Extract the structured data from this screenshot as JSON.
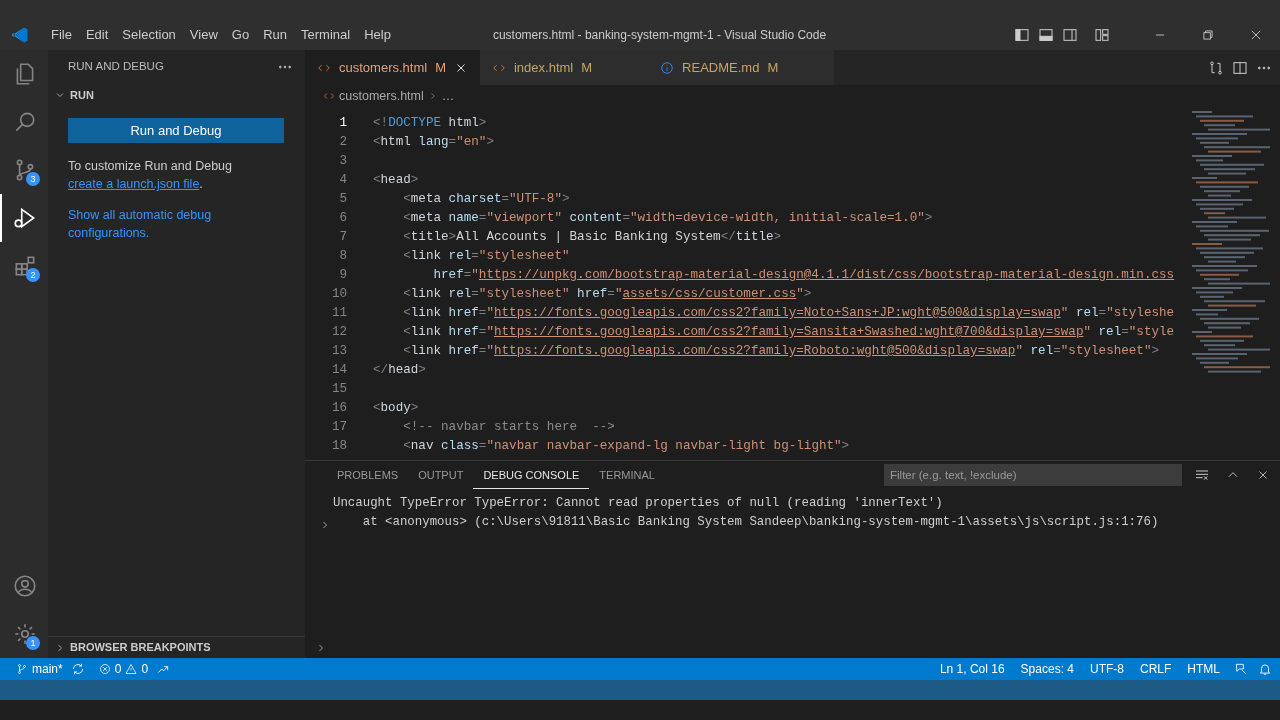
{
  "window": {
    "title": "customers.html - banking-system-mgmt-1 - Visual Studio Code"
  },
  "menu": [
    "File",
    "Edit",
    "Selection",
    "View",
    "Go",
    "Run",
    "Terminal",
    "Help"
  ],
  "activity_bar": [
    {
      "kind": "files",
      "selected": false
    },
    {
      "kind": "search",
      "selected": false
    },
    {
      "kind": "source-control",
      "badge": "3",
      "selected": false
    },
    {
      "kind": "run-debug",
      "selected": true
    },
    {
      "kind": "extensions",
      "badge": "2",
      "selected": false
    }
  ],
  "activity_bar_bottom": [
    {
      "kind": "account"
    },
    {
      "kind": "gear",
      "badge": "1"
    }
  ],
  "sidebar": {
    "title": "RUN AND DEBUG",
    "section": {
      "label": "RUN",
      "expanded": true
    },
    "button": "Run and Debug",
    "intro": "To customize Run and Debug ",
    "intro_link": "create a launch.json file",
    "intro_end": ".",
    "link": "Show all automatic debug configurations.",
    "bottom_section": {
      "label": "BROWSER BREAKPOINTS",
      "expanded": false
    }
  },
  "tabs": [
    {
      "label": "customers.html",
      "status": "M",
      "kind": "html",
      "selected": true
    },
    {
      "label": "index.html",
      "status": "M",
      "kind": "html",
      "selected": false
    },
    {
      "label": "README.md",
      "status": "M",
      "kind": "info",
      "selected": false
    }
  ],
  "breadcrumb": {
    "file": "customers.html",
    "rest": "…"
  },
  "editor": {
    "lines": [
      {
        "number": "1",
        "current": true,
        "tokens": [
          {
            "kind": "p",
            "text": "<!"
          },
          {
            "kind": "kw",
            "text": "DOCTYPE"
          },
          {
            "kind": "tag",
            "text": " html"
          },
          {
            "kind": "p",
            "text": ">"
          }
        ]
      },
      {
        "number": "2",
        "current": false,
        "tokens": [
          {
            "kind": "p",
            "text": "<"
          },
          {
            "kind": "tag",
            "text": "html"
          },
          {
            "kind": "attr",
            "text": " lang"
          },
          {
            "kind": "p",
            "text": "="
          },
          {
            "kind": "str",
            "text": "\"en\""
          },
          {
            "kind": "p",
            "text": ">"
          }
        ]
      },
      {
        "number": "3",
        "current": false
      },
      {
        "number": "4",
        "current": false,
        "tokens": [
          {
            "kind": "p",
            "text": "<"
          },
          {
            "kind": "tag",
            "text": "head"
          },
          {
            "kind": "p",
            "text": ">"
          }
        ]
      },
      {
        "number": "5",
        "current": false,
        "tokens": [
          {
            "kind": "p",
            "text": "    <"
          },
          {
            "kind": "tag",
            "text": "meta"
          },
          {
            "kind": "attr",
            "text": " charset"
          },
          {
            "kind": "p",
            "text": "="
          },
          {
            "kind": "str",
            "text": "\"UTF-8\""
          },
          {
            "kind": "p",
            "text": ">"
          }
        ]
      },
      {
        "number": "6",
        "current": false,
        "tokens": [
          {
            "kind": "p",
            "text": "    <"
          },
          {
            "kind": "tag",
            "text": "meta"
          },
          {
            "kind": "attr",
            "text": " name"
          },
          {
            "kind": "p",
            "text": "="
          },
          {
            "kind": "str",
            "text": "\"viewport\""
          },
          {
            "kind": "attr",
            "text": " content"
          },
          {
            "kind": "p",
            "text": "="
          },
          {
            "kind": "str",
            "text": "\"width=device-width, initial-scale=1.0\""
          },
          {
            "kind": "p",
            "text": ">"
          }
        ]
      },
      {
        "number": "7",
        "current": false,
        "tokens": [
          {
            "kind": "p",
            "text": "    <"
          },
          {
            "kind": "tag",
            "text": "title"
          },
          {
            "kind": "p",
            "text": ">"
          },
          {
            "kind": "txt",
            "text": "All Accounts | Basic Banking System"
          },
          {
            "kind": "p",
            "text": "</"
          },
          {
            "kind": "tag",
            "text": "title"
          },
          {
            "kind": "p",
            "text": ">"
          }
        ]
      },
      {
        "number": "8",
        "current": false,
        "tokens": [
          {
            "kind": "p",
            "text": "    <"
          },
          {
            "kind": "tag",
            "text": "link"
          },
          {
            "kind": "attr",
            "text": " rel"
          },
          {
            "kind": "p",
            "text": "="
          },
          {
            "kind": "str",
            "text": "\"stylesheet\""
          }
        ]
      },
      {
        "number": "9",
        "current": false,
        "tokens": [
          {
            "kind": "attr",
            "text": "        href"
          },
          {
            "kind": "p",
            "text": "="
          },
          {
            "kind": "str",
            "text": "\""
          },
          {
            "kind": "link",
            "text": "https://unpkg.com/bootstrap-material-design@4.1.1/dist/css/bootstrap-material-design.min.css"
          }
        ]
      },
      {
        "number": "10",
        "current": false,
        "tokens": [
          {
            "kind": "p",
            "text": "    <"
          },
          {
            "kind": "tag",
            "text": "link"
          },
          {
            "kind": "attr",
            "text": " rel"
          },
          {
            "kind": "p",
            "text": "="
          },
          {
            "kind": "str",
            "text": "\"stylesheet\""
          },
          {
            "kind": "attr",
            "text": " href"
          },
          {
            "kind": "p",
            "text": "="
          },
          {
            "kind": "str",
            "text": "\""
          },
          {
            "kind": "link",
            "text": "assets/css/customer.css"
          },
          {
            "kind": "str",
            "text": "\""
          },
          {
            "kind": "p",
            "text": ">"
          }
        ]
      },
      {
        "number": "11",
        "current": false,
        "tokens": [
          {
            "kind": "p",
            "text": "    <"
          },
          {
            "kind": "tag",
            "text": "link"
          },
          {
            "kind": "attr",
            "text": " href"
          },
          {
            "kind": "p",
            "text": "="
          },
          {
            "kind": "str",
            "text": "\""
          },
          {
            "kind": "link",
            "text": "https://fonts.googleapis.com/css2?family=Noto+Sans+JP:wght@500&display=swap"
          },
          {
            "kind": "str",
            "text": "\""
          },
          {
            "kind": "attr",
            "text": " rel"
          },
          {
            "kind": "p",
            "text": "="
          },
          {
            "kind": "str",
            "text": "\"styleshe"
          }
        ]
      },
      {
        "number": "12",
        "current": false,
        "tokens": [
          {
            "kind": "p",
            "text": "    <"
          },
          {
            "kind": "tag",
            "text": "link"
          },
          {
            "kind": "attr",
            "text": " href"
          },
          {
            "kind": "p",
            "text": "="
          },
          {
            "kind": "str",
            "text": "\""
          },
          {
            "kind": "link",
            "text": "https://fonts.googleapis.com/css2?family=Sansita+Swashed:wght@700&display=swap"
          },
          {
            "kind": "str",
            "text": "\""
          },
          {
            "kind": "attr",
            "text": " rel"
          },
          {
            "kind": "p",
            "text": "="
          },
          {
            "kind": "str",
            "text": "\"style"
          }
        ]
      },
      {
        "number": "13",
        "current": false,
        "tokens": [
          {
            "kind": "p",
            "text": "    <"
          },
          {
            "kind": "tag",
            "text": "link"
          },
          {
            "kind": "attr",
            "text": " href"
          },
          {
            "kind": "p",
            "text": "="
          },
          {
            "kind": "str",
            "text": "\""
          },
          {
            "kind": "link",
            "text": "https://fonts.googleapis.com/css2?family=Roboto:wght@500&display=swap"
          },
          {
            "kind": "str",
            "text": "\""
          },
          {
            "kind": "attr",
            "text": " rel"
          },
          {
            "kind": "p",
            "text": "="
          },
          {
            "kind": "str",
            "text": "\"stylesheet\""
          },
          {
            "kind": "p",
            "text": ">"
          }
        ]
      },
      {
        "number": "14",
        "current": false,
        "tokens": [
          {
            "kind": "p",
            "text": "</"
          },
          {
            "kind": "tag",
            "text": "head"
          },
          {
            "kind": "p",
            "text": ">"
          }
        ]
      },
      {
        "number": "15",
        "current": false
      },
      {
        "number": "16",
        "current": false,
        "tokens": [
          {
            "kind": "p",
            "text": "<"
          },
          {
            "kind": "tag",
            "text": "body"
          },
          {
            "kind": "p",
            "text": ">"
          }
        ]
      },
      {
        "number": "17",
        "current": false,
        "tokens": [
          {
            "kind": "cmt",
            "text": "    <!-- navbar starts here  -->"
          }
        ]
      },
      {
        "number": "18",
        "current": false,
        "tokens": [
          {
            "kind": "p",
            "text": "    <"
          },
          {
            "kind": "tag",
            "text": "nav"
          },
          {
            "kind": "attr",
            "text": " class"
          },
          {
            "kind": "p",
            "text": "="
          },
          {
            "kind": "str",
            "text": "\"navbar navbar-expand-lg navbar-light bg-light\""
          },
          {
            "kind": "p",
            "text": ">"
          }
        ]
      }
    ]
  },
  "panel": {
    "tabs": [
      {
        "label": "PROBLEMS",
        "selected": false
      },
      {
        "label": "OUTPUT",
        "selected": false
      },
      {
        "label": "DEBUG CONSOLE",
        "selected": true
      },
      {
        "label": "TERMINAL",
        "selected": false
      }
    ],
    "filter_placeholder": "Filter (e.g. text, !exclude)",
    "error": {
      "expanded": false,
      "lines": [
        "Uncaught TypeError TypeError: Cannot read properties of null (reading 'innerText')",
        "    at <anonymous> (c:\\Users\\91811\\Basic Banking System Sandeep\\banking-system-mgmt-1\\assets\\js\\script.js:1:76)"
      ]
    }
  },
  "status_bar": {
    "branch": "main*",
    "errors": "0",
    "warnings": "0",
    "right": [
      "Ln 1, Col 16",
      "Spaces: 4",
      "UTF-8",
      "CRLF",
      "HTML"
    ]
  }
}
